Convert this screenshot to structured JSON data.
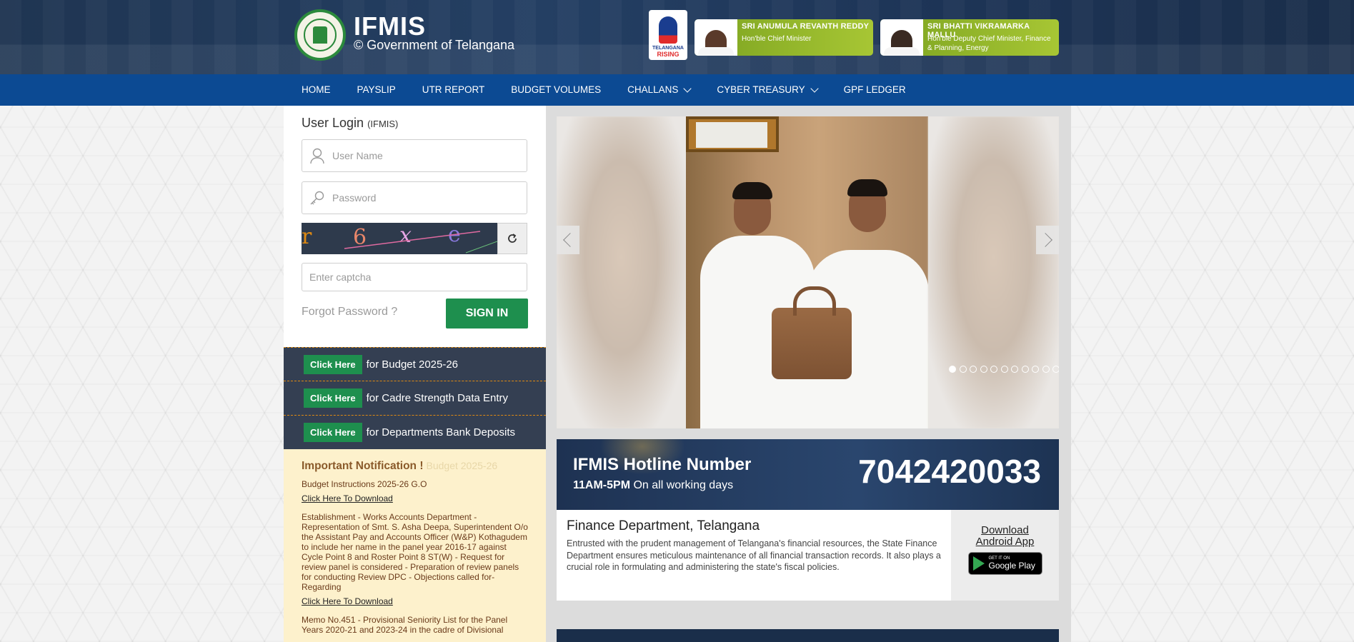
{
  "header": {
    "brand_title": "IFMIS",
    "brand_subtitle": "© Government of Telangana",
    "rising_top": "TELANGANA",
    "rising_bottom": "RISING",
    "leaders": [
      {
        "name": "SRI ANUMULA REVANTH REDDY",
        "role": "Hon'ble Chief Minister"
      },
      {
        "name": "SRI BHATTI VIKRAMARKA MALLU",
        "role": "Hon'ble Deputy Chief Minister, Finance & Planning, Energy"
      }
    ]
  },
  "nav": {
    "items": [
      "HOME",
      "PAYSLIP",
      "UTR REPORT",
      "BUDGET VOLUMES",
      "CHALLANS",
      "CYBER TREASURY",
      "GPF LEDGER"
    ]
  },
  "login": {
    "title": "User Login",
    "title_suffix": "(IFMIS)",
    "username_placeholder": "User Name",
    "password_placeholder": "Password",
    "captcha_chars": [
      "r",
      "6",
      "x",
      "e"
    ],
    "captcha_placeholder": "Enter captcha",
    "forgot": "Forgot Password ?",
    "signin": "SIGN IN"
  },
  "links": {
    "button_label": "Click Here",
    "items": [
      "for Budget 2025-26",
      "for Cadre Strength Data Entry",
      "for Departments Bank Deposits"
    ]
  },
  "notifications": {
    "title": "Important Notification !",
    "ghost": "Budget 2025-26",
    "items": [
      {
        "text": "Budget Instructions 2025-26 G.O",
        "link": "Click Here To Download"
      },
      {
        "text": "Establishment - Works Accounts Department - Representation of Smt. S. Asha Deepa, Superintendent O/o the Assistant Pay and Accounts Officer (W&P) Kothagudem to include her name in the panel year 2016-17 against Cycle Point 8 and Roster Point 8 ST(W) - Request for review panel is considered - Preparation of review panels for conducting Review DPC - Objections called for-Regarding",
        "link": "Click Here To Download"
      },
      {
        "text": "Memo No.451 - Provisional Seniority List for the Panel Years 2020-21 and 2023-24 in the cadre of Divisional"
      }
    ]
  },
  "carousel": {
    "slide_count": 11,
    "active_index": 0
  },
  "hotline": {
    "title": "IFMIS Hotline Number",
    "hours": "11AM-5PM",
    "days": "On all working days",
    "number": "7042420033"
  },
  "finance": {
    "title": "Finance Department, Telangana",
    "text": "Entrusted with the prudent management of Telangana's financial resources, the State Finance Department ensures meticulous maintenance of all financial transaction records. It also plays a crucial role in formulating and administering the state's fiscal policies."
  },
  "app": {
    "line1": "Download",
    "line2": "Android App",
    "store_small": "GET IT ON",
    "store_big": "Google Play"
  }
}
